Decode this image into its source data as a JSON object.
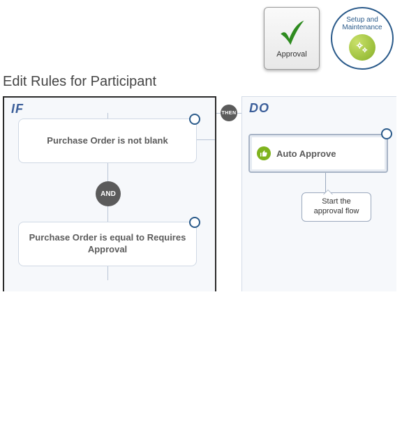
{
  "badges": {
    "approval_label": "Approval",
    "setup_label": "Setup and\nMaintenance"
  },
  "page_title": "Edit Rules for Participant",
  "if_panel": {
    "header": "IF",
    "connector_then": "THEN",
    "connector_and": "AND",
    "conditions": [
      "Purchase Order is not blank",
      "Purchase Order is equal to Requires Approval"
    ]
  },
  "do_panel": {
    "header": "DO",
    "action_label": "Auto Approve",
    "callout": "Start the approval flow"
  },
  "colors": {
    "panel_header": "#3c5f9a",
    "badge_circle": "#5b5b5b",
    "action_green": "#7fb31e",
    "setup_green": "#9bbf3b",
    "approval_check": "#2e8b1f",
    "handle_blue": "#2a5a8a"
  }
}
